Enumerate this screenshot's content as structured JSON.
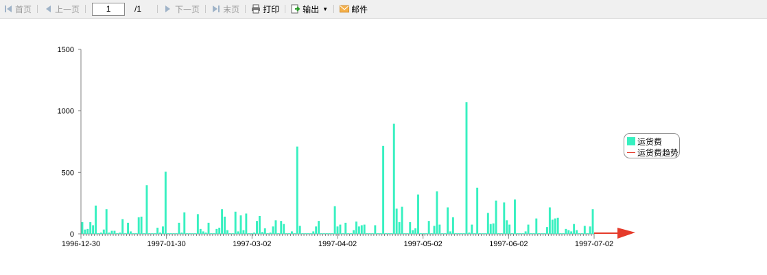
{
  "toolbar": {
    "first_label": "首页",
    "prev_label": "上一页",
    "page_value": "1",
    "page_total": "/1",
    "next_label": "下一页",
    "last_label": "末页",
    "print_label": "打印",
    "export_label": "输出",
    "mail_label": "邮件"
  },
  "colors": {
    "bar": "#37f0c0",
    "trend": "#e53a2a",
    "axis": "#808080"
  },
  "chart_data": {
    "type": "bar",
    "ylim": [
      0,
      1500
    ],
    "yticks": [
      "0",
      "500",
      "1000",
      "1500"
    ],
    "x_tick_labels": [
      "1996-12-30",
      "1997-01-30",
      "1997-03-02",
      "1997-04-02",
      "1997-05-02",
      "1997-06-02",
      "1997-07-02"
    ],
    "series": [
      {
        "name": "运货费",
        "values": [
          95,
          35,
          40,
          95,
          70,
          230,
          5,
          10,
          35,
          200,
          10,
          25,
          25,
          5,
          10,
          120,
          5,
          90,
          20,
          5,
          5,
          135,
          140,
          5,
          395,
          5,
          5,
          5,
          50,
          10,
          60,
          505,
          5,
          5,
          5,
          5,
          90,
          10,
          175,
          5,
          5,
          5,
          5,
          160,
          40,
          20,
          10,
          90,
          5,
          5,
          40,
          50,
          200,
          140,
          30,
          5,
          5,
          180,
          20,
          150,
          30,
          165,
          5,
          5,
          10,
          105,
          145,
          15,
          45,
          5,
          10,
          60,
          110,
          5,
          105,
          80,
          5,
          5,
          20,
          5,
          710,
          65,
          5,
          5,
          5,
          5,
          20,
          60,
          105,
          5,
          5,
          5,
          5,
          5,
          225,
          60,
          75,
          5,
          90,
          5,
          5,
          30,
          100,
          60,
          70,
          75,
          5,
          5,
          5,
          70,
          5,
          5,
          715,
          5,
          5,
          5,
          895,
          205,
          95,
          220,
          5,
          5,
          95,
          30,
          45,
          320,
          5,
          5,
          5,
          105,
          5,
          65,
          345,
          75,
          5,
          5,
          215,
          20,
          135,
          5,
          5,
          5,
          5,
          1070,
          10,
          75,
          5,
          375,
          5,
          5,
          5,
          170,
          80,
          85,
          270,
          5,
          5,
          255,
          110,
          75,
          5,
          280,
          5,
          5,
          5,
          20,
          75,
          5,
          5,
          125,
          5,
          5,
          5,
          55,
          215,
          115,
          125,
          130,
          5,
          5,
          40,
          30,
          20,
          80,
          30,
          5,
          5,
          65,
          5,
          60,
          200
        ]
      },
      {
        "name": "运货费趋势",
        "values": []
      }
    ]
  }
}
